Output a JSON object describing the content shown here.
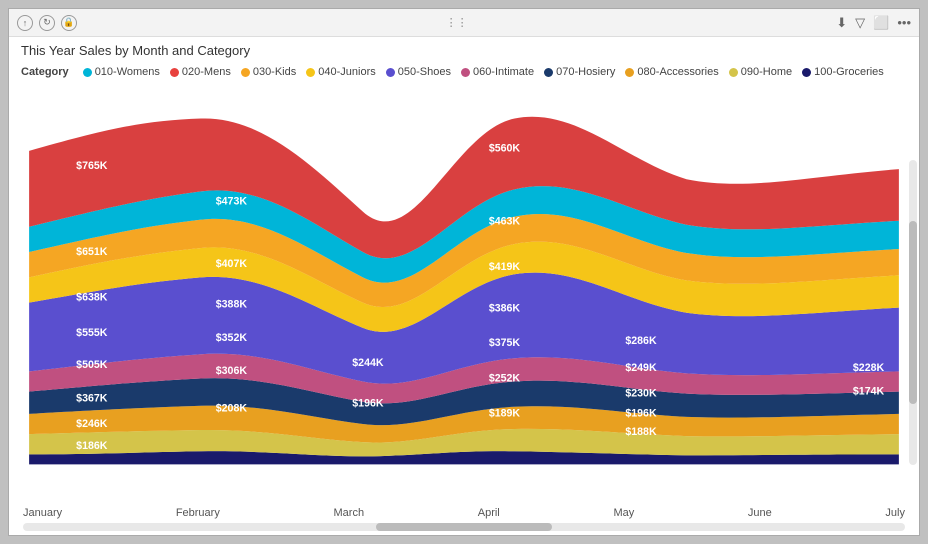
{
  "window": {
    "title": "This Year Sales by Month and Category"
  },
  "titlebar": {
    "icons": [
      "up-icon",
      "refresh-icon",
      "lock-icon"
    ],
    "center": "⋯",
    "right_icons": [
      "download-icon",
      "filter-icon",
      "expand-icon",
      "more-icon"
    ]
  },
  "legend": {
    "label": "Category",
    "items": [
      {
        "name": "010-Womens",
        "color": "#00B5D8"
      },
      {
        "name": "020-Mens",
        "color": "#E8413E"
      },
      {
        "name": "030-Kids",
        "color": "#F5A623"
      },
      {
        "name": "040-Juniors",
        "color": "#F5C518"
      },
      {
        "name": "050-Shoes",
        "color": "#5A4FCF"
      },
      {
        "name": "060-Intimate",
        "color": "#E8413E"
      },
      {
        "name": "070-Hosiery",
        "color": "#1A3A6B"
      },
      {
        "name": "080-Accessories",
        "color": "#F5A623"
      },
      {
        "name": "090-Home",
        "color": "#D4C44A"
      },
      {
        "name": "100-Groceries",
        "color": "#1A1A6B"
      }
    ]
  },
  "months": [
    "January",
    "February",
    "March",
    "April",
    "May",
    "June",
    "July"
  ],
  "values": {
    "january": [
      "$765K",
      "$651K",
      "$638K",
      "$555K",
      "$505K",
      "$367K",
      "$246K",
      "$186K"
    ],
    "february": [
      "$473K",
      "$407K",
      "$388K",
      "$352K",
      "$306K",
      "$208K"
    ],
    "march": [
      "$244K",
      "$196K"
    ],
    "april": [
      "$560K",
      "$463K",
      "$419K",
      "$386K",
      "$375K",
      "$252K",
      "$189K"
    ],
    "may": [
      "$286K",
      "$249K",
      "$230K",
      "$196K",
      "$188K"
    ],
    "july": [
      "$228K",
      "$174K"
    ]
  },
  "colors": {
    "red": "#D94040",
    "yellow": "#F5C518",
    "blue_dark": "#3B4CA8",
    "gray_blue": "#8899BB",
    "orange": "#F5A623",
    "teal": "#00B5D8",
    "light_blue": "#7EC8E3",
    "gold": "#C8A020",
    "navy": "#1A3A6B",
    "dark_navy": "#1A1A6B"
  }
}
